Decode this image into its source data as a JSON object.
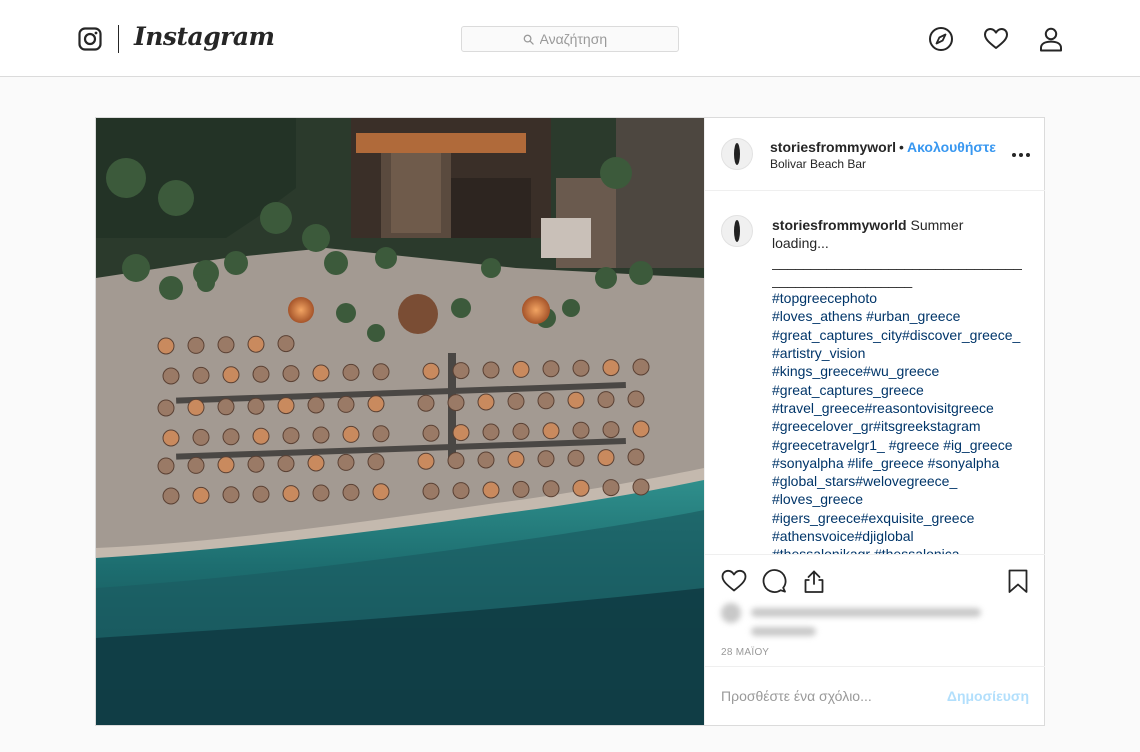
{
  "nav": {
    "logo_text": "Instagram",
    "search_placeholder": "Αναζήτηση",
    "icons": [
      "instagram-glyph-icon",
      "compass-icon",
      "heart-icon",
      "profile-icon"
    ]
  },
  "post": {
    "author": {
      "username": "storiesfrommyworl",
      "separator": "•",
      "follow_label": "Ακολουθήστε",
      "location": "Bolivar Beach Bar"
    },
    "caption": {
      "username": "storiesfrommyworld",
      "text_line1": "Summer",
      "text_line2": "loading...",
      "rule1": "__________________________________",
      "rule2": "__________________",
      "hashtags": [
        "#topgreecephoto",
        "#loves_athens #urban_greece",
        "#great_captures_city#discover_greece_",
        "#artistry_vision",
        "#kings_greece#wu_greece",
        "#great_captures_greece",
        "#travel_greece#reasontovisitgreece",
        "#greecelover_gr#itsgreekstagram",
        "#greecetravelgr1_ #greece #ig_greece",
        "#sonyalpha #life_greece #sonyalpha",
        "#global_stars#welovegreece_",
        "#loves_greece",
        "#igers_greece#exquisite_greece",
        "#athensvoice#djiglobal",
        "#thessalonikagr #thessalonica"
      ]
    },
    "date": "28 ΜΑΪΟΥ",
    "comment_placeholder": "Προσθέστε ένα σχόλιο...",
    "post_button": "Δημοσίευση",
    "colors": {
      "link_blue": "#3897f0",
      "post_button_disabled": "#b2dffc",
      "hashtag": "#003569",
      "border": "#dbdbdb"
    }
  }
}
